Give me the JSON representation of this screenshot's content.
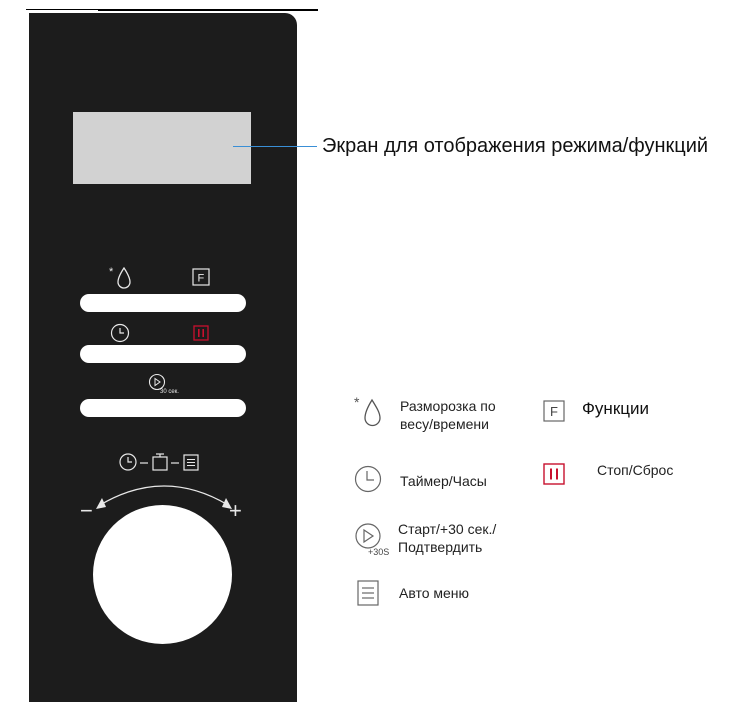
{
  "screen_callout": {
    "label": "Экран для отображения режима/функций"
  },
  "panel": {
    "start_label": "30 сек.",
    "plus": "+",
    "minus": "−"
  },
  "legend": {
    "defrost": "Разморозка по\nвесу/времени",
    "functions": "Функции",
    "timer": "Таймер/Часы",
    "stop": "Стоп/Сброс",
    "start": "Старт/+30 сек./\nПодтвердить",
    "start_icon_text": "+30S",
    "auto_menu": "Авто меню",
    "f_letter": "F"
  },
  "colors": {
    "panel": "#1c1c1c",
    "accent_red": "#c8102e",
    "leader_blue": "#3a8fd6",
    "display": "#d2d2d2"
  }
}
